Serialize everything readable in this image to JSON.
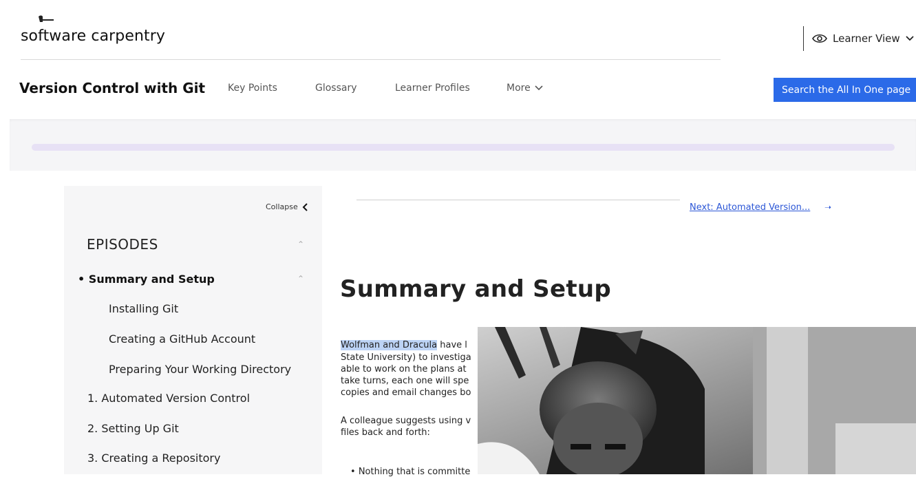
{
  "header": {
    "logo_text": "software carpentry",
    "learner_view_label": "Learner View"
  },
  "lesson_nav": {
    "title": "Version Control with Git",
    "links": [
      "Key Points",
      "Glossary",
      "Learner Profiles"
    ],
    "more_label": "More",
    "search_label": "Search the All In One page"
  },
  "progress": {
    "fraction": 0
  },
  "sidebar": {
    "collapse_label": "Collapse",
    "episodes_header": "EPISODES",
    "current_episode": "Summary and Setup",
    "sub_items": [
      "Installing Git",
      "Creating a GitHub Account",
      "Preparing Your Working Directory"
    ],
    "episodes": [
      "1. Automated Version Control",
      "2. Setting Up Git",
      "3. Creating a Repository"
    ]
  },
  "main": {
    "next_link": "Next: Automated Version...",
    "title": "Summary and Setup",
    "para1_highlight": "Wolfman and Dracula",
    "para1_lines": [
      " have l",
      "State University) to investiga",
      "able to work on the plans at",
      "take turns, each one will spe",
      "copies and email changes bo"
    ],
    "para2_lines": [
      "A colleague suggests using v",
      "files back and forth:"
    ],
    "bullet_text": "Nothing that is committe"
  },
  "colors": {
    "accent_blue": "#2b6ae8",
    "link_blue": "#2b56d6",
    "progress_track": "#e7e1f5",
    "progress_fill": "#c4b7ef"
  }
}
